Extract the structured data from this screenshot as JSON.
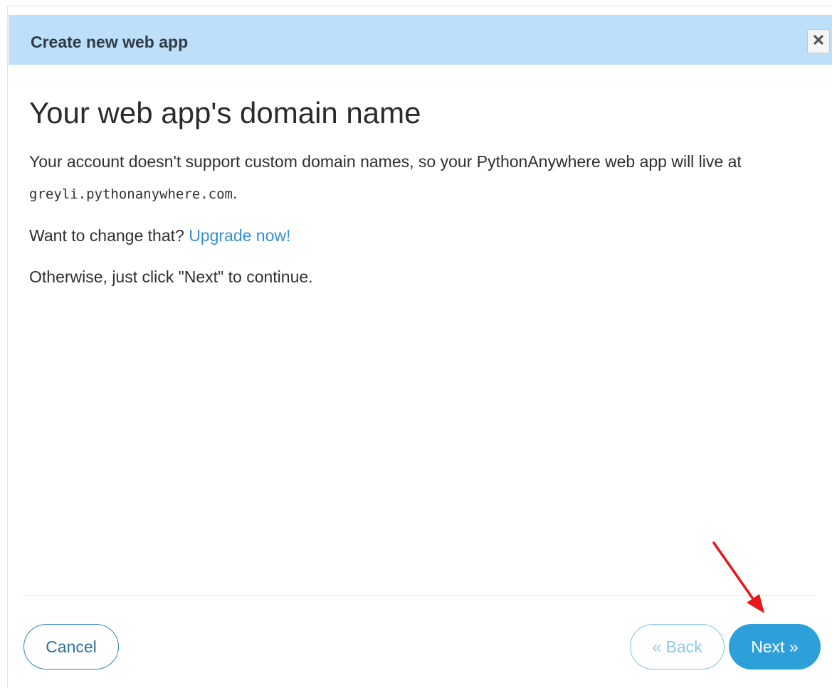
{
  "dialog": {
    "title": "Create new web app",
    "close_icon": "close-x-icon"
  },
  "content": {
    "heading": "Your web app's domain name",
    "p1_before": "Your account doesn't support custom domain names, so your PythonAnywhere web app will live at ",
    "domain": "greyli.pythonanywhere.com",
    "p1_after": ".",
    "p2_text": "Want to change that? ",
    "upgrade_link": "Upgrade now!",
    "p3_text": "Otherwise, just click \"Next\" to continue."
  },
  "footer": {
    "cancel_label": "Cancel",
    "back_label": "« Back",
    "next_label": "Next »"
  },
  "annotation": {
    "arrow_color": "#e8151b"
  },
  "colors": {
    "header_bg": "#bddff9",
    "primary": "#2ea0d9",
    "link": "#3a8fd0"
  }
}
